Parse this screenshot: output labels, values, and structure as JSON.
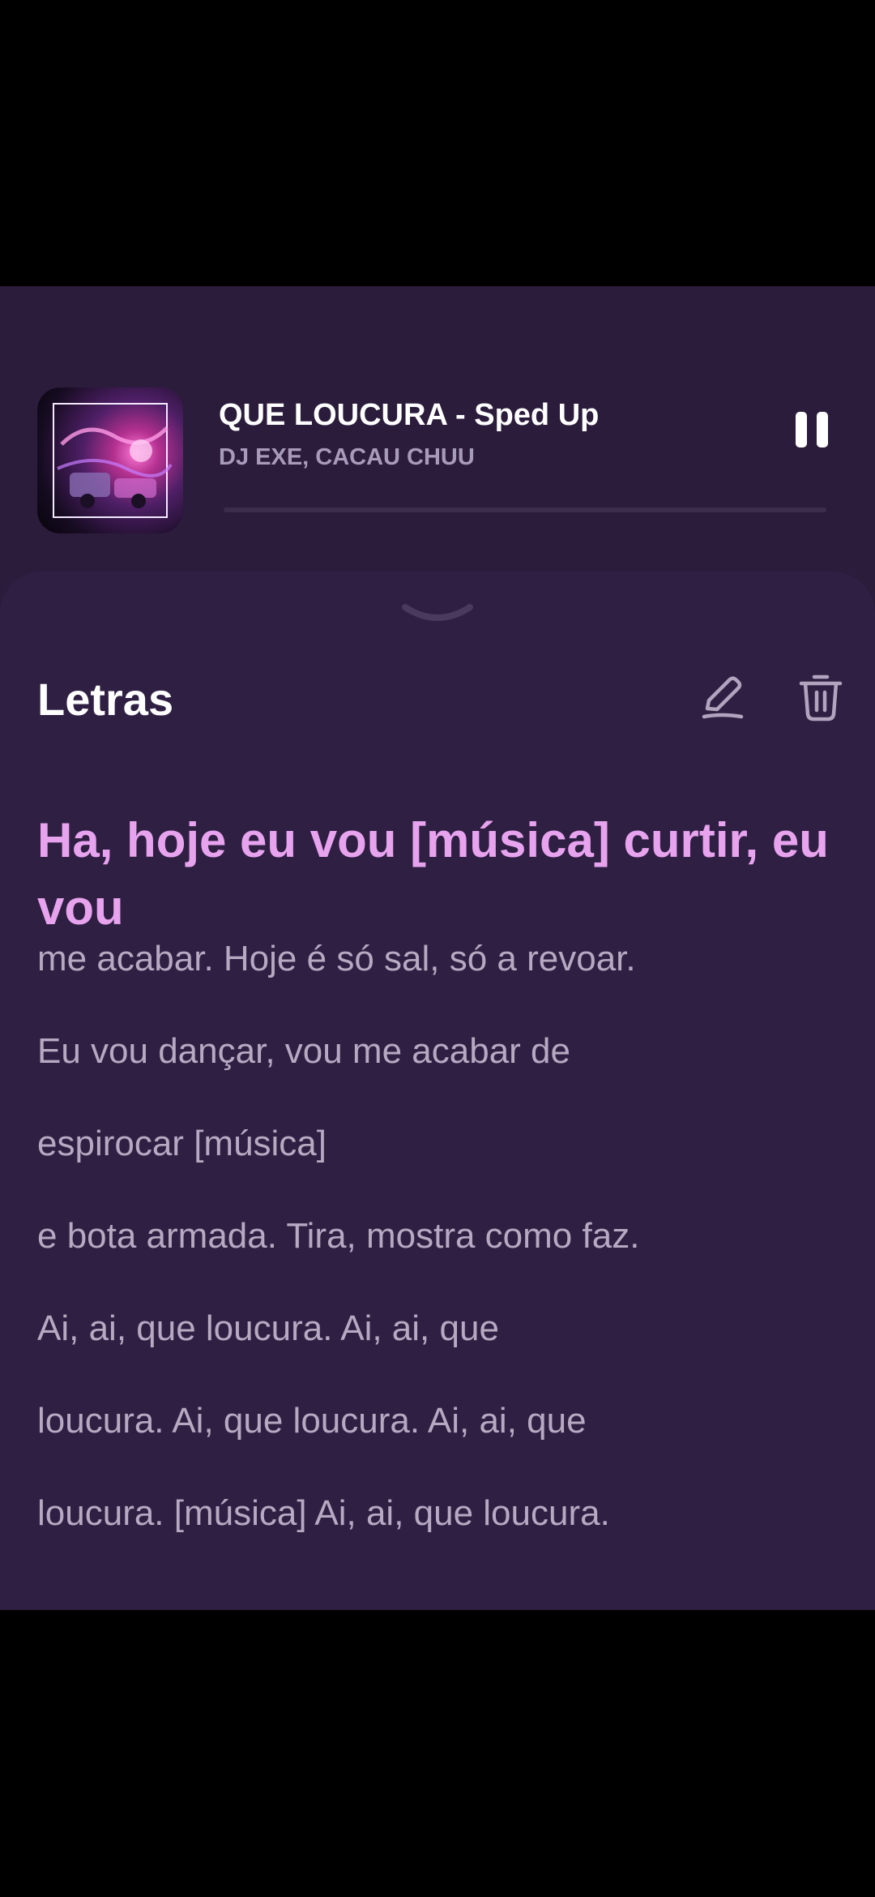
{
  "now_playing": {
    "title": "QUE LOUCURA - Sped Up",
    "artist": "DJ EXE, CACAU CHUU",
    "progress": 0.0
  },
  "lyrics_panel": {
    "title": "Letras",
    "edit_icon": "pencil-icon",
    "delete_icon": "trash-icon",
    "active_line": "Ha, hoje eu vou [música] curtir, eu vou",
    "lines": [
      "me acabar. Hoje é só sal, só a revoar.",
      "Eu vou dançar, vou me acabar de",
      "espirocar [música]",
      "e bota armada. Tira, mostra como faz.",
      "Ai, ai, que loucura. Ai, ai, que",
      "loucura. Ai, que loucura. Ai, ai, que",
      "loucura. [música] Ai, ai, que loucura."
    ]
  },
  "colors": {
    "background": "#2b1c3c",
    "sheet": "#2f1f43",
    "active_lyric": "#e8a3ef",
    "lyric": "#b7a9c2"
  }
}
